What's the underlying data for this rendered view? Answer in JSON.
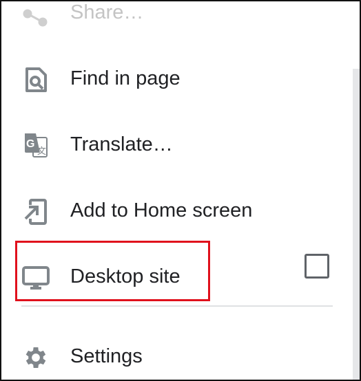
{
  "menu": {
    "items": [
      {
        "label": "Share…",
        "icon": "share-icon"
      },
      {
        "label": "Find in page",
        "icon": "find-in-page-icon"
      },
      {
        "label": "Translate…",
        "icon": "translate-icon"
      },
      {
        "label": "Add to Home screen",
        "icon": "add-to-home-screen-icon"
      },
      {
        "label": "Desktop site",
        "icon": "desktop-icon",
        "checked": false
      },
      {
        "label": "Settings",
        "icon": "gear-icon"
      }
    ]
  },
  "colors": {
    "icon": "#80868b",
    "text": "#202124",
    "highlight": "#e0101c",
    "checkbox": "#5f6368"
  }
}
